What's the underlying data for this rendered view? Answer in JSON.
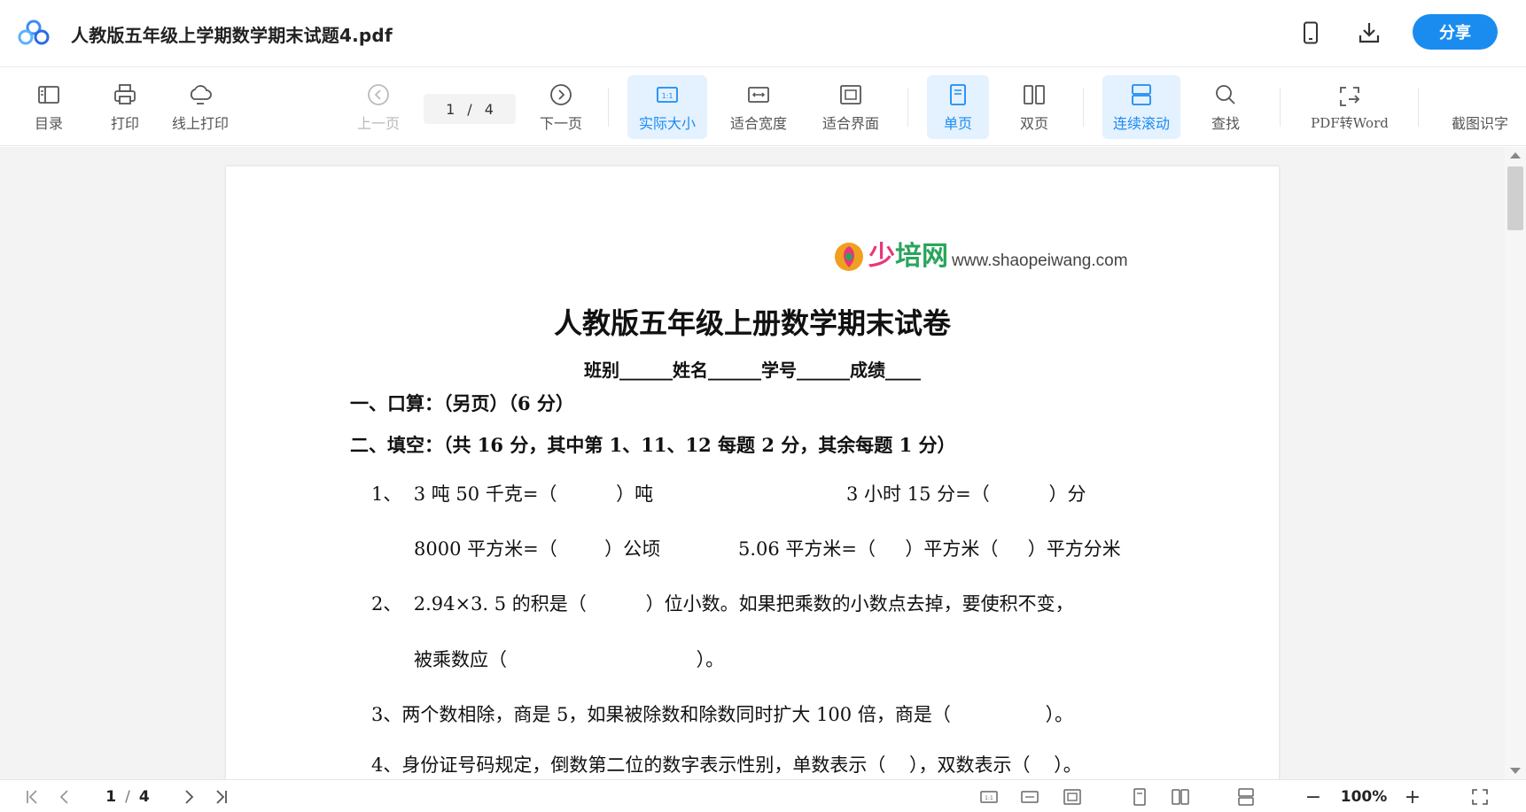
{
  "titlebar": {
    "doc_title": "人教版五年级上学期数学期末试题4.pdf",
    "share_label": "分享",
    "icons": [
      "app-logo",
      "mobile-icon",
      "download-icon"
    ]
  },
  "toolbar": {
    "toc": "目录",
    "print": "打印",
    "online_print": "线上打印",
    "prev_page": "上一页",
    "page_current": "1",
    "page_sep": "/",
    "page_total": "4",
    "next_page": "下一页",
    "actual_size": "实际大小",
    "fit_width": "适合宽度",
    "fit_page": "适合界面",
    "single_page": "单页",
    "double_page": "双页",
    "continuous_scroll": "连续滚动",
    "search": "查找",
    "pdf_to_word": "PDF转Word",
    "ocr": "截图识字"
  },
  "document": {
    "brand_cn_1": "少",
    "brand_cn_2": "培网",
    "brand_url": "www.shaopeiwang.com",
    "title": "人教版五年级上册数学期末试卷",
    "info_line": "班别______姓名______学号______成绩____",
    "lines": [
      "一、口算：（另页）（6 分）",
      "二、填空：（共 16 分，其中第 1、11、12 每题 2 分，其余每题 1 分）",
      "1、  3 吨 50 千克=（          ）吨",
      "3 小时 15 分=（          ）分",
      "8000 平方米=（        ）公顷",
      "5.06 平方米=（     ）平方米（     ）平方分米",
      "2、  2.94×3. 5 的积是（          ）位小数。如果把乘数的小数点去掉，要使积不变，",
      "被乘数应（                                ）。",
      "3、两个数相除，商是 5，如果被除数和除数同时扩大 100 倍，商是（                ）。",
      "4、身份证号码规定，倒数第二位的数字表示性别，单数表示（    ），双数表示（    ）。"
    ]
  },
  "bottombar": {
    "page_current": "1",
    "page_sep": "/",
    "page_total": "4",
    "zoom_minus": "−",
    "zoom": "100%",
    "zoom_plus": "+"
  },
  "colors": {
    "accent": "#1a8cf0",
    "active_bg": "#e4f1ff",
    "disabled": "#b9b9b9",
    "viewer_bg": "#f3f3f3"
  }
}
